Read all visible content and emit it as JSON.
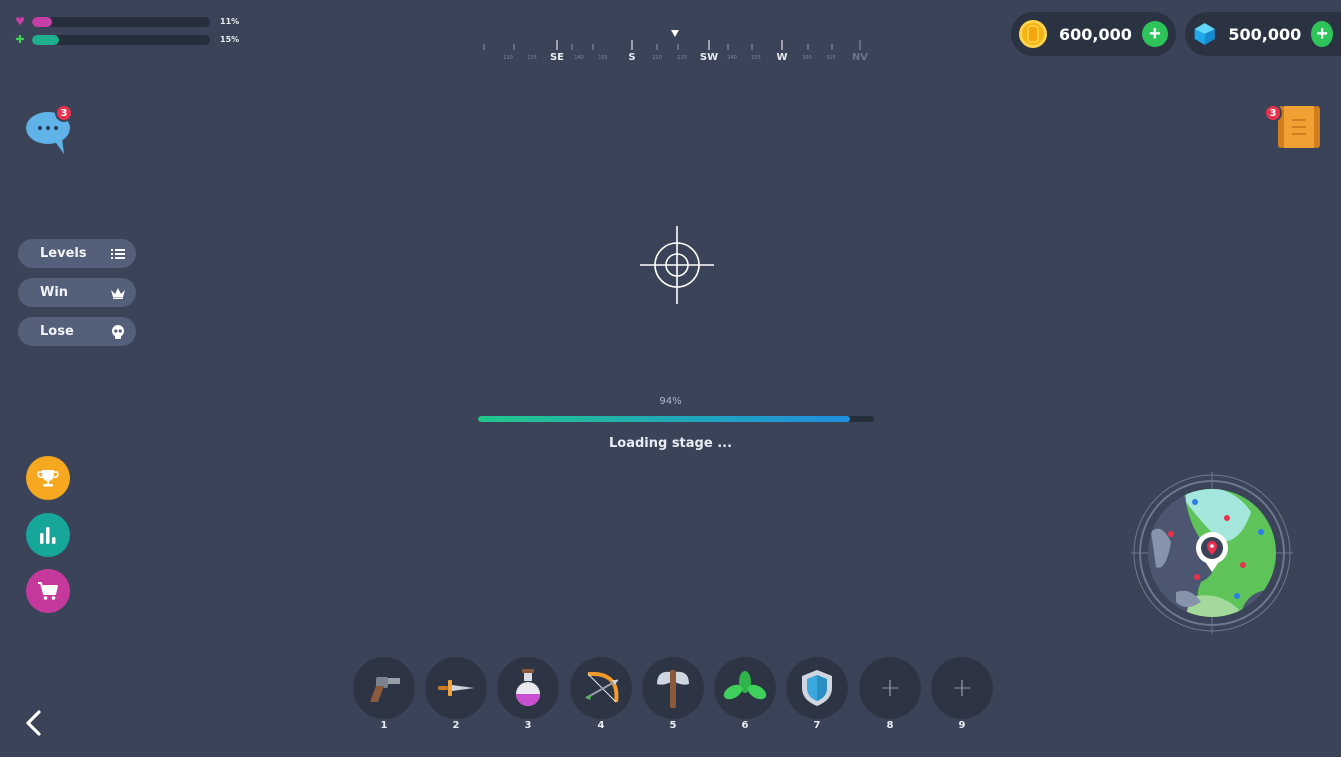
{
  "hud": {
    "health": {
      "icon": "heart-icon",
      "percent_label": "11%",
      "fill": 0.11,
      "color": "#c53fa6"
    },
    "stamina": {
      "icon": "plus-cross-icon",
      "percent_label": "15%",
      "fill": 0.15,
      "color": "#1fb08e"
    }
  },
  "compass": {
    "labels": [
      "SE",
      "S",
      "SW",
      "W",
      "NV"
    ],
    "minor_ticks": [
      "120",
      "135",
      "140",
      "165",
      "210",
      "225",
      "240",
      "255",
      "300",
      "315"
    ]
  },
  "currency": {
    "coins": {
      "value": "600,000",
      "icon": "coin-icon",
      "add_icon": "plus-icon"
    },
    "gems": {
      "value": "500,000",
      "icon": "gem-icon",
      "add_icon": "plus-icon"
    }
  },
  "chat": {
    "icon": "chat-bubble-icon",
    "badge": "3"
  },
  "quests": {
    "icon": "scroll-icon",
    "badge": "3"
  },
  "menu": [
    {
      "label": "Levels",
      "icon": "list-icon"
    },
    {
      "label": "Win",
      "icon": "crown-icon"
    },
    {
      "label": "Lose",
      "icon": "skull-icon"
    }
  ],
  "round_buttons": [
    {
      "name": "trophy",
      "icon": "trophy-icon",
      "color": "#f6a821"
    },
    {
      "name": "stats",
      "icon": "bar-chart-icon",
      "color": "#17a79a"
    },
    {
      "name": "shop",
      "icon": "cart-icon",
      "color": "#c5399d"
    }
  ],
  "loading": {
    "percent_label": "94%",
    "progress": 0.94,
    "text": "Loading stage ..."
  },
  "hotbar": [
    {
      "num": "1",
      "icon": "revolver-icon"
    },
    {
      "num": "2",
      "icon": "dagger-icon"
    },
    {
      "num": "3",
      "icon": "potion-icon"
    },
    {
      "num": "4",
      "icon": "bow-icon"
    },
    {
      "num": "5",
      "icon": "axe-icon"
    },
    {
      "num": "6",
      "icon": "leaf-icon"
    },
    {
      "num": "7",
      "icon": "shield-icon"
    },
    {
      "num": "8",
      "icon": "plus-icon"
    },
    {
      "num": "9",
      "icon": "plus-icon"
    }
  ],
  "nav": {
    "back_icon": "chevron-left-icon"
  },
  "minimap": {
    "icon": "minimap-icon",
    "marker_icon": "location-pin-icon"
  }
}
